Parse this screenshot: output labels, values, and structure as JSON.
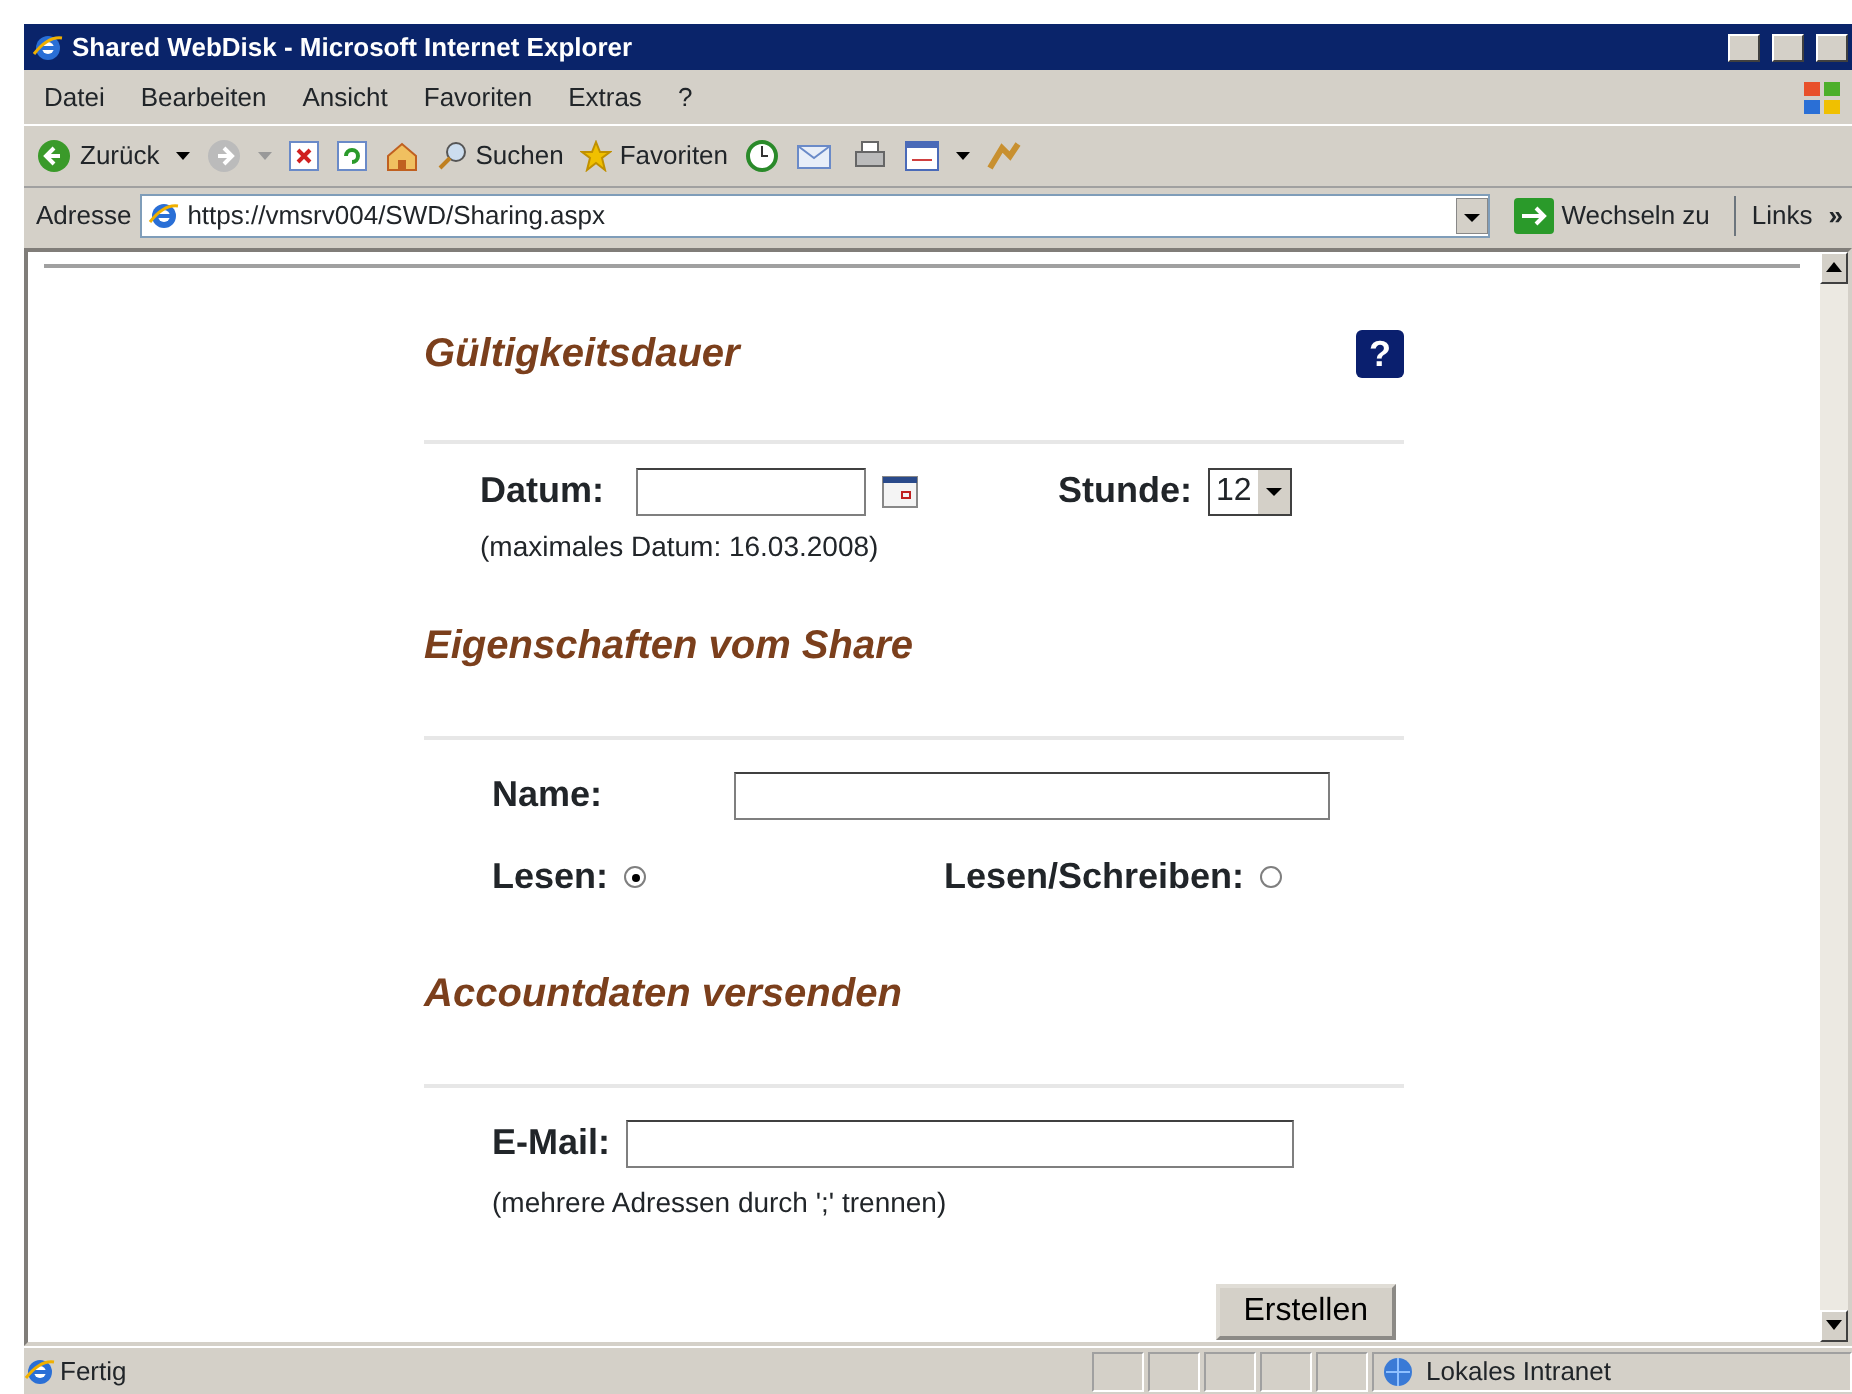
{
  "window": {
    "title": "Shared WebDisk - Microsoft Internet Explorer"
  },
  "menu": [
    "Datei",
    "Bearbeiten",
    "Ansicht",
    "Favoriten",
    "Extras",
    "?"
  ],
  "toolbar": {
    "back": "Zurück",
    "search": "Suchen",
    "favorites": "Favoriten"
  },
  "address": {
    "label": "Adresse",
    "url": "https://vmsrv004/SWD/Sharing.aspx",
    "go": "Wechseln zu",
    "links": "Links",
    "more": "»"
  },
  "validity": {
    "heading": "Gültigkeitsdauer",
    "help": "?",
    "date_label": "Datum:",
    "hour_label": "Stunde:",
    "hour": "12",
    "hint": "(maximales Datum: 16.03.2008)"
  },
  "share": {
    "heading": "Eigenschaften vom Share",
    "name_label": "Name:",
    "access": [
      {
        "label": "Lesen:",
        "selected": true
      },
      {
        "label": "Lesen/Schreiben:",
        "selected": false
      }
    ]
  },
  "account": {
    "heading": "Accountdaten versenden",
    "email_label": "E-Mail:",
    "hint": "(mehrere Adressen durch ';' trennen)"
  },
  "submit": "Erstellen",
  "status": {
    "text": "Fertig",
    "zone": "Lokales Intranet"
  }
}
